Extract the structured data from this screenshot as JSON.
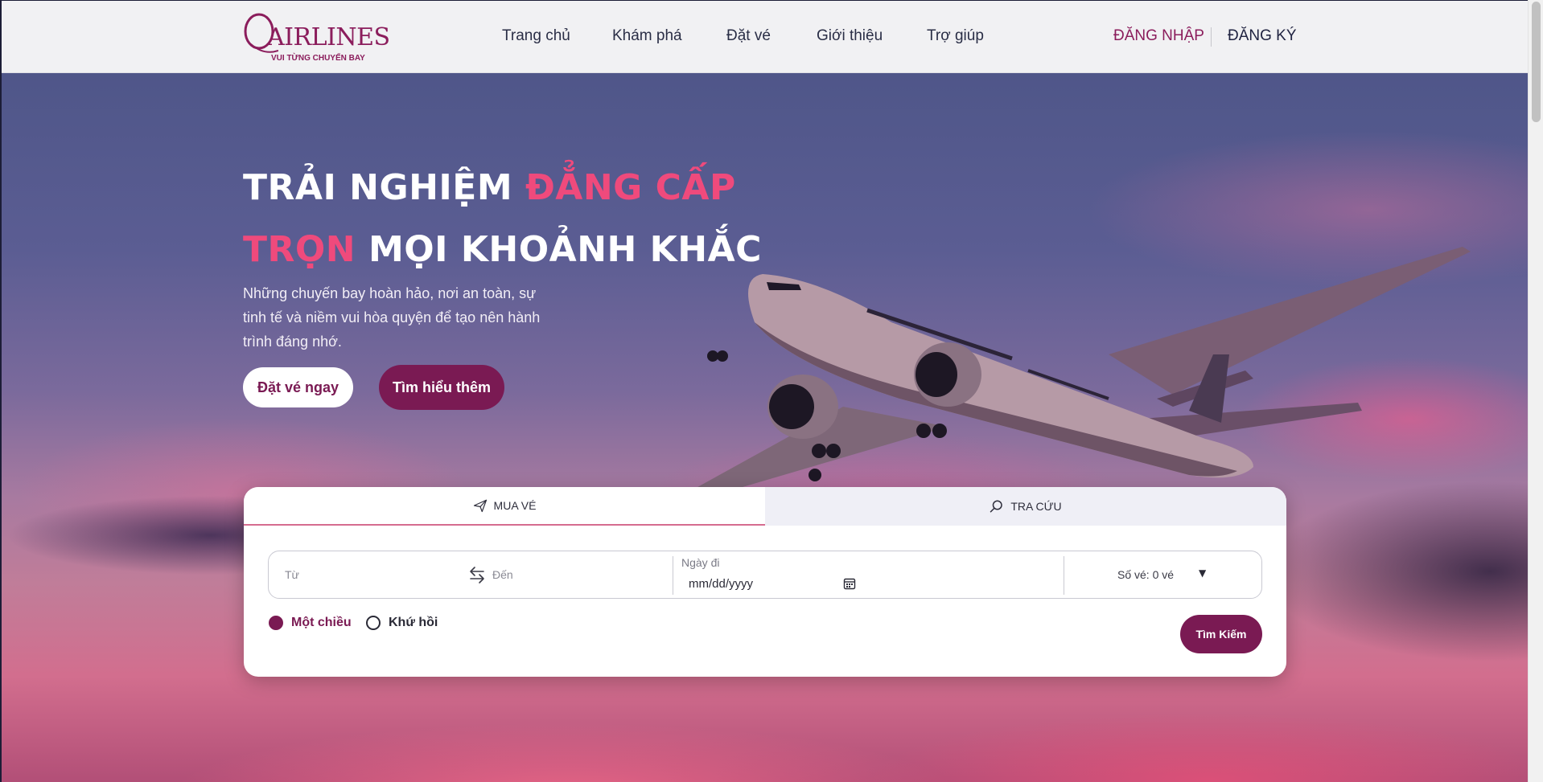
{
  "brand": {
    "name": "AIRLINES",
    "tagline": "VUI TỪNG CHUYẾN BAY",
    "accent_color": "#7a1a53",
    "highlight_color": "#ef4a7c"
  },
  "nav": {
    "items": [
      "Trang chủ",
      "Khám phá",
      "Đặt vé",
      "Giới thiệu",
      "Trợ giúp"
    ],
    "login_label": "ĐĂNG NHẬP",
    "register_label": "ĐĂNG KÝ"
  },
  "hero": {
    "title_line1_white": "TRẢI NGHIỆM ",
    "title_line1_pink": "ĐẲNG CẤP",
    "title_line2_pink": "TRỌN",
    "title_line2_white": " MỌI KHOẢNH KHẮC",
    "subtitle": "Những chuyến bay hoàn hảo, nơi an toàn, sự tinh tế và niềm vui hòa quyện để tạo nên hành trình đáng nhớ.",
    "book_button": "Đặt vé ngay",
    "learn_button": "Tìm hiểu thêm"
  },
  "booking": {
    "tabs": [
      {
        "label": "MUA VÉ",
        "icon": "plane-icon",
        "active": true
      },
      {
        "label": "TRA CỨU",
        "icon": "search-icon",
        "active": false
      }
    ],
    "from_placeholder": "Từ",
    "to_placeholder": "Đến",
    "date_label": "Ngày đi",
    "date_value": "mm/dd/yyyy",
    "tickets_label": "Số vé: 0 vé",
    "trip_types": [
      {
        "label": "Một chiều",
        "selected": true
      },
      {
        "label": "Khứ hồi",
        "selected": false
      }
    ],
    "search_button": "Tìm Kiếm"
  }
}
